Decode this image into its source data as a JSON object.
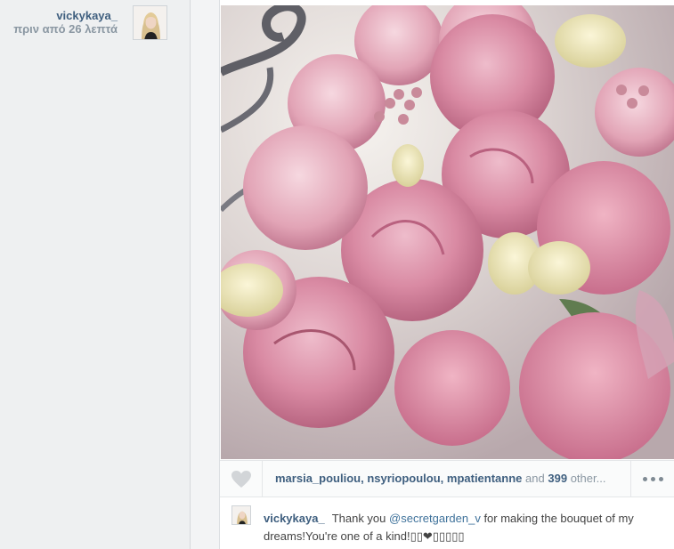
{
  "author": {
    "username": "vickykaya_",
    "time_ago": "πριν από 26 λεπτά"
  },
  "likes": {
    "likers": [
      "marsia_pouliou",
      "nsyriopoulou",
      "mpatientanne"
    ],
    "and_text": "and",
    "count": "399",
    "others_text": "other..."
  },
  "caption": {
    "username": "vickykaya_",
    "text_before": "Thank you ",
    "mention": "@secretgarden_v",
    "text_after": " for making the bouquet of my dreams!You're one of a kind!▯▯❤▯▯▯▯▯"
  },
  "icons": {
    "like": "heart-icon",
    "more": "more-options-icon"
  },
  "colors": {
    "link": "#3f5f7f",
    "muted": "#8a97a2",
    "mention": "#3f729b"
  }
}
